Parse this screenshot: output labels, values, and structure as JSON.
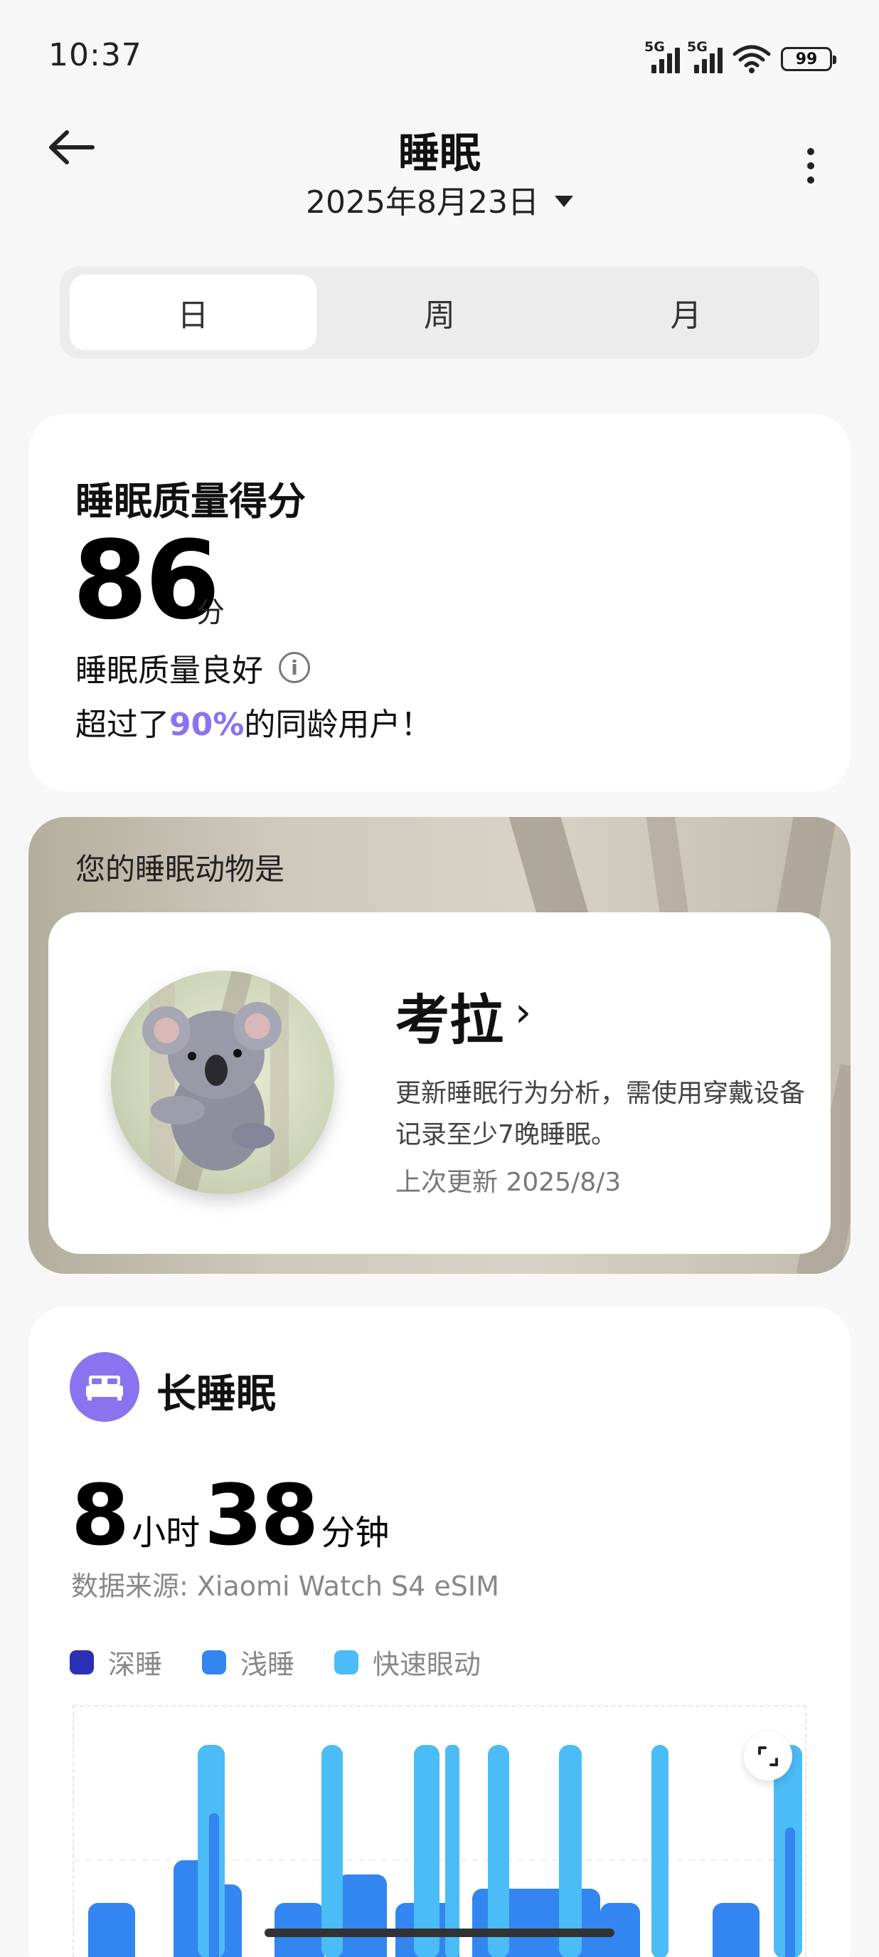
{
  "status_bar": {
    "time": "10:37",
    "signal_1_label": "5G",
    "signal_2_label": "5G",
    "battery": "99",
    "icons": [
      "signal-5g-icon",
      "signal-5g-icon",
      "wifi-icon",
      "battery-icon"
    ]
  },
  "header": {
    "title": "睡眠",
    "date": "2025年8月23日",
    "icons": [
      "back-arrow-icon",
      "dropdown-caret-icon",
      "more-vertical-icon"
    ]
  },
  "tabs": [
    {
      "label": "日",
      "active": true
    },
    {
      "label": "周",
      "active": false
    },
    {
      "label": "月",
      "active": false
    }
  ],
  "score_card": {
    "label": "睡眠质量得分",
    "score": "86",
    "unit": "分",
    "quality": "睡眠质量良好",
    "percent_prefix": "超过了",
    "percent": "90%",
    "percent_suffix": "的同龄用户！"
  },
  "animal_card": {
    "title": "您的睡眠动物是",
    "animal": "考拉",
    "chevron": "›",
    "description": "更新睡眠行为分析，需使用穿戴设备记录至少7晚睡眠。",
    "updated": "上次更新 2025/8/3"
  },
  "sleep_card": {
    "title": "长睡眠",
    "hours": "8",
    "hours_unit": "小时",
    "minutes": "38",
    "minutes_unit": "分钟",
    "source": "数据来源: Xiaomi Watch S4 eSIM",
    "legend": [
      {
        "label": "深睡",
        "color": "#2b2fb3"
      },
      {
        "label": "浅睡",
        "color": "#3385f0"
      },
      {
        "label": "快速眼动",
        "color": "#4bbcf5"
      }
    ]
  },
  "colors": {
    "accent": "#8a73ef",
    "deep": "#2b2fb3",
    "light": "#3385f0",
    "rem": "#4bbcf5"
  }
}
